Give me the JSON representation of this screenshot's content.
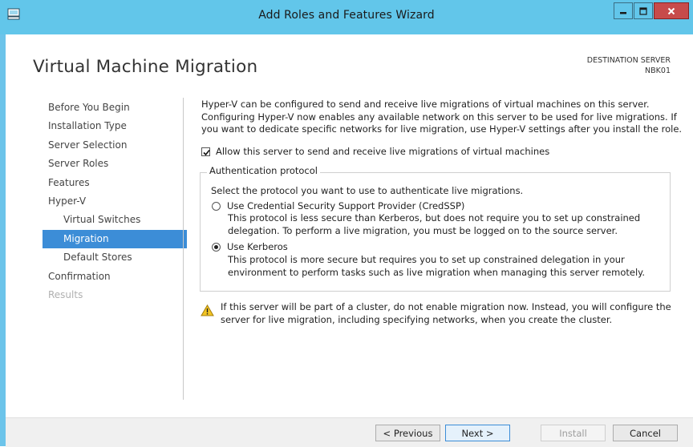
{
  "window": {
    "title": "Add Roles and Features Wizard",
    "icons": {
      "app": "server-manager-icon",
      "minimize": "minimize-icon",
      "maximize": "maximize-icon",
      "close": "close-icon"
    }
  },
  "header": {
    "page_title": "Virtual Machine Migration",
    "destination_label": "DESTINATION SERVER",
    "destination_value": "NBK01"
  },
  "nav": {
    "items": [
      {
        "label": "Before You Begin"
      },
      {
        "label": "Installation Type"
      },
      {
        "label": "Server Selection"
      },
      {
        "label": "Server Roles"
      },
      {
        "label": "Features"
      },
      {
        "label": "Hyper-V"
      },
      {
        "label": "Virtual Switches"
      },
      {
        "label": "Migration"
      },
      {
        "label": "Default Stores"
      },
      {
        "label": "Confirmation"
      },
      {
        "label": "Results"
      }
    ],
    "active": "Migration"
  },
  "content": {
    "intro": "Hyper-V can be configured to send and receive live migrations of virtual machines on this server. Configuring Hyper-V now enables any available network on this server to be used for live migrations. If you want to dedicate specific networks for live migration, use Hyper-V settings after you install the role.",
    "allow_checkbox": {
      "label": "Allow this server to send and receive live migrations of virtual machines",
      "checked": true
    },
    "auth_group": {
      "legend": "Authentication protocol",
      "description": "Select the protocol you want to use to authenticate live migrations.",
      "options": [
        {
          "label": "Use Credential Security Support Provider (CredSSP)",
          "description": "This protocol is less secure than Kerberos, but does not require you to set up constrained delegation. To perform a live migration, you must be logged on to the source server.",
          "selected": false
        },
        {
          "label": "Use Kerberos",
          "description": "This protocol is more secure but requires you to set up constrained delegation in your environment to perform tasks such as live migration when managing this server remotely.",
          "selected": true
        }
      ]
    },
    "warning": {
      "icon": "warning-icon",
      "text": "If this server will be part of a cluster, do not enable migration now. Instead, you will configure the server for live migration, including specifying networks, when you create the cluster."
    }
  },
  "footer": {
    "previous_label": "< Previous",
    "next_label": "Next >",
    "install_label": "Install",
    "cancel_label": "Cancel"
  },
  "colors": {
    "titlebar": "#62c6ea",
    "nav_active": "#3c8dd7",
    "close_button": "#c74b4b"
  }
}
